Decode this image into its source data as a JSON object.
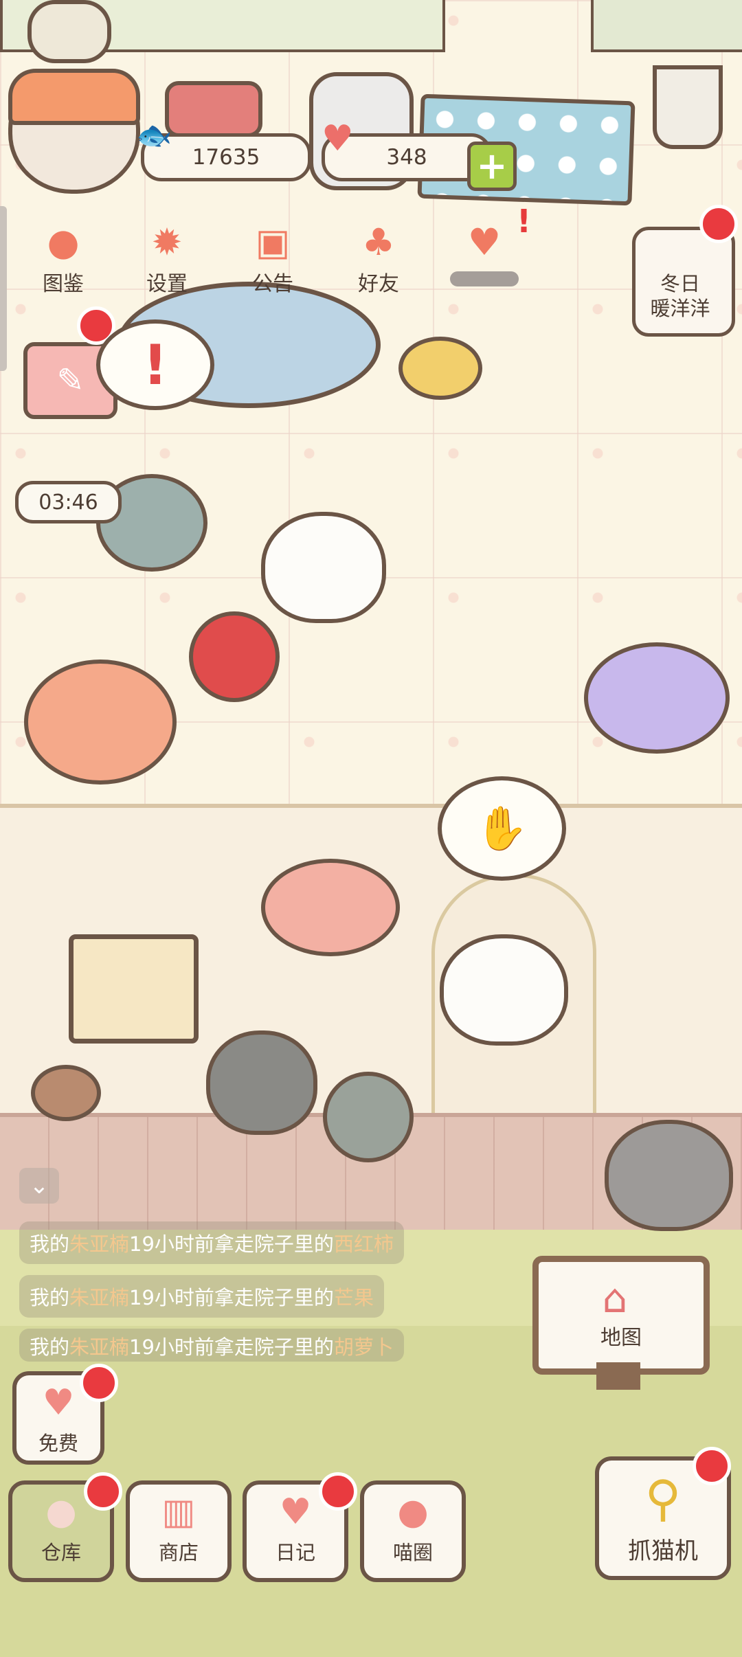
{
  "currency": {
    "coins": "17635",
    "hearts": "348"
  },
  "top_menu": [
    {
      "label": "图鉴",
      "icon": "cat-face-icon"
    },
    {
      "label": "设置",
      "icon": "gear-icon"
    },
    {
      "label": "公告",
      "icon": "gift-icon"
    },
    {
      "label": "好友",
      "icon": "friends-icon"
    },
    {
      "label": "",
      "icon": "event-icon"
    }
  ],
  "event_badge": {
    "line1": "冬日",
    "line2": "暖洋洋"
  },
  "timer": "03:46",
  "chat_log": [
    {
      "prefix": "我的",
      "name": "朱亚楠",
      "middle": "19小时前拿走院子里的",
      "item": "西红柿"
    },
    {
      "prefix": "我的",
      "name": "朱亚楠",
      "middle": "19小时前拿走院子里的",
      "item": "芒果"
    },
    {
      "prefix": "我的",
      "name": "朱亚楠",
      "middle": "19小时前拿走院子里的",
      "item": "胡萝卜"
    }
  ],
  "map_sign": {
    "label": "地图"
  },
  "bottom_buttons": {
    "free": "免费",
    "storage": "仓库",
    "shop": "商店",
    "diary": "日记",
    "circle": "喵圈",
    "claw": "抓猫机"
  },
  "colors": {
    "notify_dot": "#e93a3f",
    "outline": "#6b5546",
    "yard": "#d6d99b"
  }
}
